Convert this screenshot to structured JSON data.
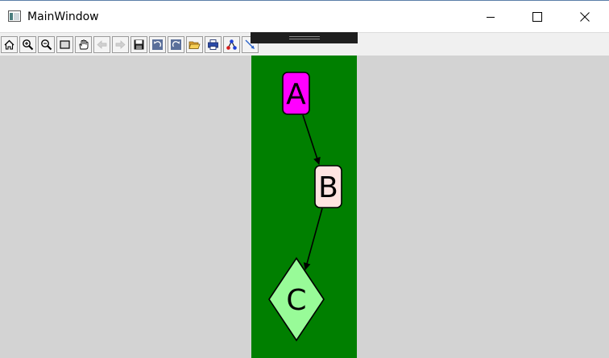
{
  "window": {
    "title": "MainWindow",
    "icons": {
      "app": "app-window-icon",
      "minimize": "minimize-icon",
      "maximize": "maximize-icon",
      "close": "close-icon"
    }
  },
  "toolbar": {
    "tools": [
      {
        "name": "home-icon"
      },
      {
        "name": "zoom-in-icon"
      },
      {
        "name": "zoom-out-icon"
      },
      {
        "name": "rectangle-select-icon"
      },
      {
        "name": "pan-hand-icon"
      },
      {
        "name": "back-arrow-icon"
      },
      {
        "name": "forward-arrow-icon"
      },
      {
        "name": "save-icon"
      },
      {
        "name": "undo-icon"
      },
      {
        "name": "redo-icon"
      },
      {
        "name": "open-folder-icon"
      },
      {
        "name": "print-icon"
      },
      {
        "name": "graph-layout-icon"
      },
      {
        "name": "edge-tool-icon"
      }
    ]
  },
  "colors": {
    "canvas_background": "#d3d3d3",
    "graph_background": "#007f00",
    "node_a_fill": "#ff00ff",
    "node_b_fill": "#ffe4e1",
    "node_c_fill": "#98fb98",
    "edge_color": "#000000"
  },
  "graph": {
    "nodes": [
      {
        "id": "A",
        "label": "A",
        "shape": "rounded-rectangle"
      },
      {
        "id": "B",
        "label": "B",
        "shape": "rounded-rectangle"
      },
      {
        "id": "C",
        "label": "C",
        "shape": "diamond"
      }
    ],
    "edges": [
      {
        "from": "A",
        "to": "B"
      },
      {
        "from": "B",
        "to": "C"
      }
    ]
  }
}
